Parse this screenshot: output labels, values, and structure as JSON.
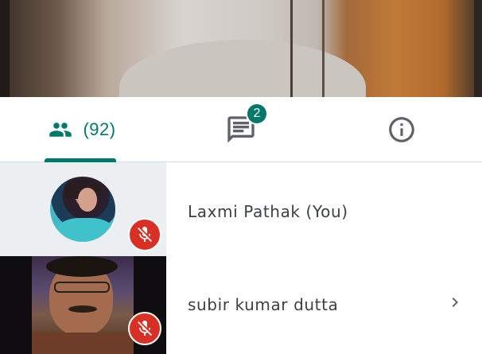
{
  "tabs": {
    "people": {
      "icon": "people-icon",
      "count_label": "(92)"
    },
    "chat": {
      "icon": "chat-icon",
      "badge": "2"
    },
    "info": {
      "icon": "info-icon"
    }
  },
  "participants": [
    {
      "name": "Laxmi Pathak (You)",
      "muted": true,
      "tile": "avatar-photo"
    },
    {
      "name": "subir kumar dutta",
      "muted": true,
      "tile": "video-thumbnail",
      "has_details": true
    }
  ],
  "colors": {
    "accent": "#00796b",
    "mute": "#d93025",
    "text": "#3c4043",
    "icon": "#5f6368"
  }
}
